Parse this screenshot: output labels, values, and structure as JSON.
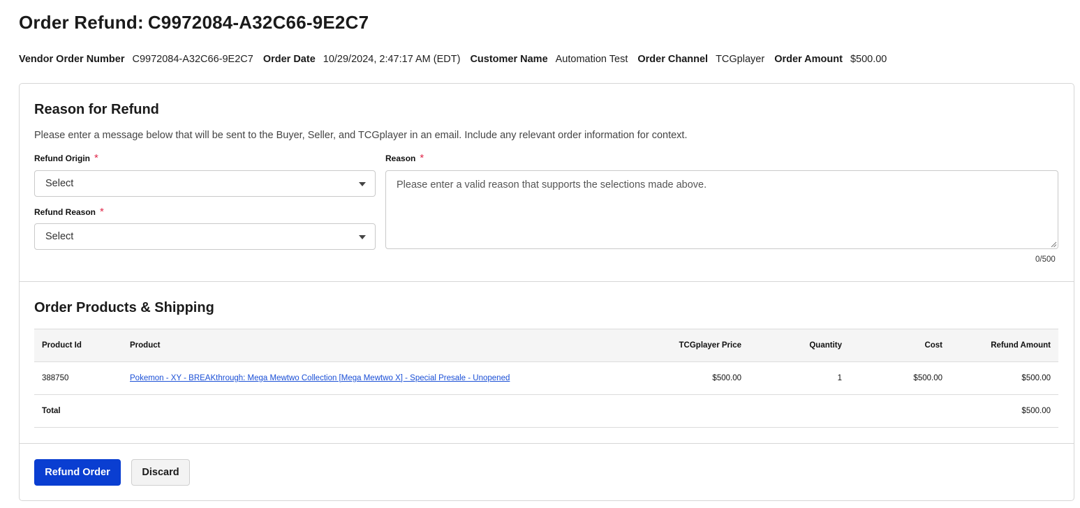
{
  "header": {
    "title_prefix": "Order Refund:",
    "order_id": "C9972084-A32C66-9E2C7"
  },
  "meta": [
    {
      "label": "Vendor Order Number",
      "value": "C9972084-A32C66-9E2C7"
    },
    {
      "label": "Order Date",
      "value": "10/29/2024, 2:47:17 AM (EDT)"
    },
    {
      "label": "Customer Name",
      "value": "Automation Test"
    },
    {
      "label": "Order Channel",
      "value": "TCGplayer"
    },
    {
      "label": "Order Amount",
      "value": "$500.00"
    }
  ],
  "reason_section": {
    "title": "Reason for Refund",
    "instructions": "Please enter a message below that will be sent to the Buyer, Seller, and TCGplayer in an email. Include any relevant order information for context.",
    "refund_origin": {
      "label": "Refund Origin",
      "required_mark": "*",
      "value": "Select"
    },
    "refund_reason": {
      "label": "Refund Reason",
      "required_mark": "*",
      "value": "Select"
    },
    "reason": {
      "label": "Reason",
      "required_mark": "*",
      "placeholder": "Please enter a valid reason that supports the selections made above.",
      "char_count": "0/500"
    }
  },
  "products_section": {
    "title": "Order Products & Shipping",
    "columns": [
      "Product Id",
      "Product",
      "TCGplayer Price",
      "Quantity",
      "Cost",
      "Refund Amount"
    ],
    "rows": [
      {
        "product_id": "388750",
        "product": "Pokemon - XY - BREAKthrough: Mega Mewtwo Collection [Mega Mewtwo X] - Special Presale - Unopened",
        "price": "$500.00",
        "quantity": "1",
        "cost": "$500.00",
        "refund_amount": "$500.00"
      }
    ],
    "total": {
      "label": "Total",
      "refund_amount": "$500.00"
    }
  },
  "actions": {
    "primary_label": "Refund Order",
    "secondary_label": "Discard"
  },
  "colors": {
    "primary": "#0a3ed1",
    "required": "#e0284a",
    "link": "#1a4fd6"
  }
}
